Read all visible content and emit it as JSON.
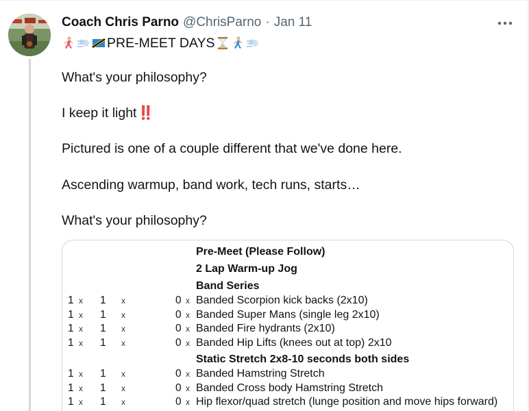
{
  "tweet": {
    "author_name": "Coach Chris Parno",
    "handle": "@ChrisParno",
    "separator": "·",
    "date": "Jan 11",
    "headline_text": "PRE-MEET DAYS",
    "paragraphs": [
      "What's your philosophy?",
      "I keep it light",
      "Pictured is one of a couple different that we've done here.",
      "Ascending warmup, band work, tech runs, starts…",
      "What's your philosophy?"
    ],
    "bangs": "‼️",
    "headline_emojis": [
      "runner-emoji",
      "dash-emoji",
      "flag-emoji",
      "hourglass-emoji",
      "runner-emoji",
      "dash-emoji"
    ]
  },
  "document": {
    "title": "Pre-Meet (Please Follow)",
    "warmup": "2 Lap Warm-up Jog",
    "band_header": "Band Series",
    "band_items": [
      {
        "sets": "1",
        "x1": "x",
        "reps": "1",
        "x2": "x",
        "weight": "0",
        "x3": "x",
        "name": "Banded Scorpion kick backs (2x10)"
      },
      {
        "sets": "1",
        "x1": "x",
        "reps": "1",
        "x2": "x",
        "weight": "0",
        "x3": "x",
        "name": "Banded Super Mans (single leg 2x10)"
      },
      {
        "sets": "1",
        "x1": "x",
        "reps": "1",
        "x2": "x",
        "weight": "0",
        "x3": "x",
        "name": "Banded Fire hydrants (2x10)"
      },
      {
        "sets": "1",
        "x1": "x",
        "reps": "1",
        "x2": "x",
        "weight": "0",
        "x3": "x",
        "name": "Banded Hip Lifts (knees out at top) 2x10"
      }
    ],
    "stretch_header": "Static Stretch 2x8-10 seconds both sides",
    "stretch_items": [
      {
        "sets": "1",
        "x1": "x",
        "reps": "1",
        "x2": "x",
        "weight": "0",
        "x3": "x",
        "name": "Banded Hamstring Stretch"
      },
      {
        "sets": "1",
        "x1": "x",
        "reps": "1",
        "x2": "x",
        "weight": "0",
        "x3": "x",
        "name": "Banded Cross body Hamstring Stretch"
      },
      {
        "sets": "1",
        "x1": "x",
        "reps": "1",
        "x2": "x",
        "weight": "0",
        "x3": "x",
        "name": "Hip flexor/quad stretch (lunge position and move hips forward)"
      }
    ]
  },
  "icons": {
    "more": "more-horizontal-icon"
  },
  "colors": {
    "text": "#0f1419",
    "secondary": "#536471",
    "border": "#cfd9de",
    "bangs": "#d9232d"
  }
}
